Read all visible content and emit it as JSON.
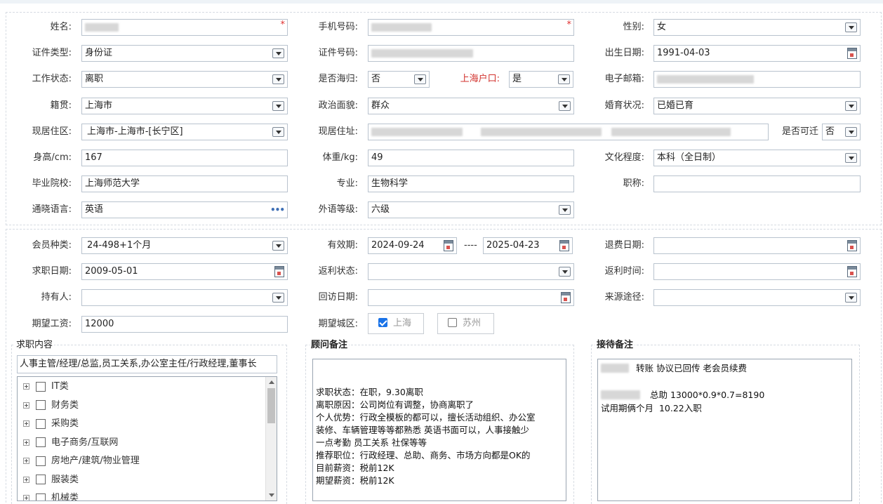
{
  "basic": {
    "name_label": "姓名:",
    "phone_label": "手机号码:",
    "gender_label": "性别:",
    "gender_value": "女",
    "idtype_label": "证件类型:",
    "idtype_value": "身份证",
    "idno_label": "证件号码:",
    "birth_label": "出生日期:",
    "birth_value": "1991-04-03",
    "workstatus_label": "工作状态:",
    "workstatus_value": "离职",
    "returnee_label": "是否海归:",
    "returnee_value": "否",
    "hukou_label": "上海户口:",
    "hukou_value": "是",
    "email_label": "电子邮箱:",
    "native_label": "籍贯:",
    "native_value": "上海市",
    "political_label": "政治面貌:",
    "political_value": "群众",
    "marital_label": "婚育状况:",
    "marital_value": "已婚已育",
    "area_label": "现居住区:",
    "area_value": "上海市-上海市-[长宁区]",
    "address_label": "现居住址:",
    "relocate_label": "是否可迁",
    "relocate_value": "否",
    "height_label": "身高/cm:",
    "height_value": "167",
    "weight_label": "体重/kg:",
    "weight_value": "49",
    "edu_label": "文化程度:",
    "edu_value": "本科（全日制）",
    "school_label": "毕业院校:",
    "school_value": "上海师范大学",
    "major_label": "专业:",
    "major_value": "生物科学",
    "title_label": "职称:",
    "lang_label": "通晓语言:",
    "lang_value": "英语",
    "langlevel_label": "外语等级:",
    "langlevel_value": "六级"
  },
  "membership": {
    "type_label": "会员种类:",
    "type_value": "24-498+1个月",
    "valid_label": "有效期:",
    "valid_from": "2024-09-24",
    "valid_sep": "----",
    "valid_to": "2025-04-23",
    "refund_label": "退费日期:",
    "jobdate_label": "求职日期:",
    "jobdate_value": "2009-05-01",
    "rebate_status_label": "返利状态:",
    "rebate_time_label": "返利时间:",
    "holder_label": "持有人:",
    "revisit_label": "回访日期:",
    "source_label": "来源途径:",
    "salary_label": "期望工资:",
    "salary_value": "12000",
    "city_label": "期望城区:",
    "city_shanghai": "上海",
    "city_suzhou": "苏州"
  },
  "job_content": {
    "title": "求职内容",
    "summary": "人事主管/经理/总监,员工关系,办公室主任/行政经理,董事长",
    "tree": [
      {
        "label": "IT类"
      },
      {
        "label": "财务类"
      },
      {
        "label": "采购类"
      },
      {
        "label": "电子商务/互联网"
      },
      {
        "label": "房地产/建筑/物业管理"
      },
      {
        "label": "服装类"
      },
      {
        "label": "机械类"
      }
    ]
  },
  "advisor_note": {
    "title": "顾问备注",
    "text": "\n\n求职状态：在职，9.30离职\n离职原因：公司岗位有调整，协商离职了\n个人优势：行政全模板的都可以，擅长活动组织、办公室\n装修、车辆管理等等都熟悉 英语书面可以，人事接触少\n一点考勤 员工关系 社保等等\n推荐职位：行政经理、总助、商务、市场方向都是OK的\n目前薪资：税前12K\n期望薪资：税前12K"
  },
  "reception_note": {
    "title": "接待备注",
    "line1": "转账 协议已回传 老会员续费",
    "line2": "总助 13000*0.9*0.7=8190",
    "line3": "试用期俩个月  10.22入职"
  },
  "colors": {
    "required": "#e03030",
    "hukou_label": "#d2322d",
    "checkbox_on": "#1a73e8"
  }
}
